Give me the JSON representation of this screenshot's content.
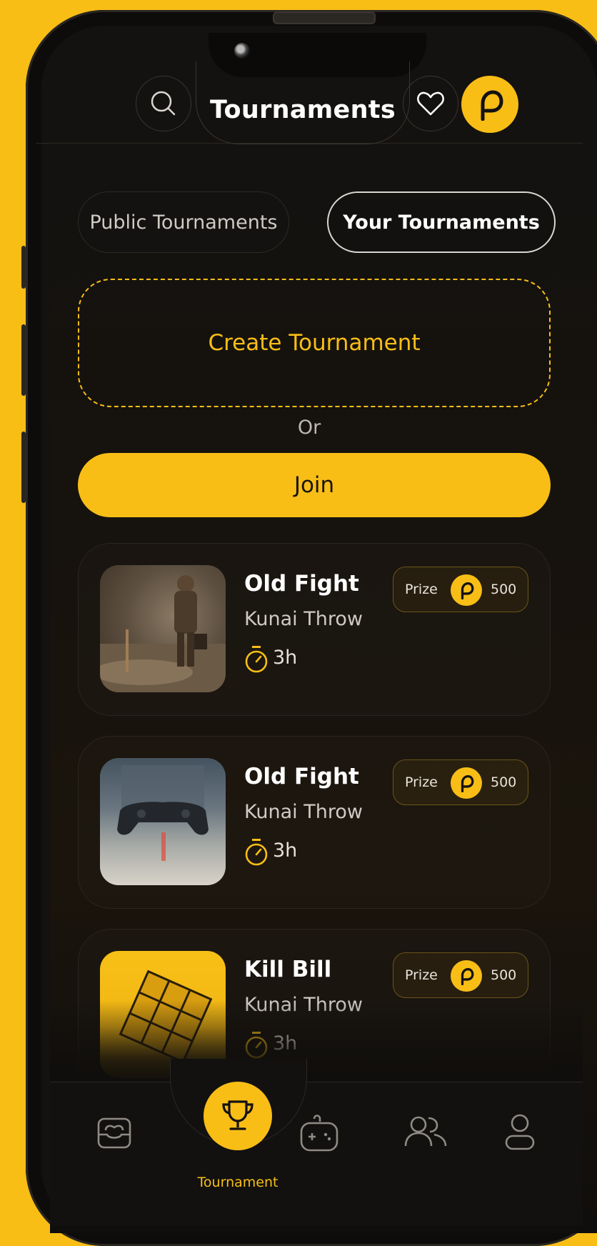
{
  "header": {
    "title": "Tournaments",
    "search_icon": "search-icon",
    "favorite_icon": "heart-icon",
    "profile_badge_letter": "P"
  },
  "tabs": [
    {
      "label": "Public Tournaments",
      "active": false
    },
    {
      "label": "Your Tournaments",
      "active": true
    }
  ],
  "create": {
    "label": "Create Tournament"
  },
  "separator": "Or",
  "join": {
    "label": "Join"
  },
  "tournaments": [
    {
      "title": "Old Fight",
      "game": "Kunai Throw",
      "time": "3h",
      "prize_label": "Prize",
      "prize_amount": "500"
    },
    {
      "title": "Old Fight",
      "game": "Kunai Throw",
      "time": "3h",
      "prize_label": "Prize",
      "prize_amount": "500"
    },
    {
      "title": "Kill Bill",
      "game": "Kunai Throw",
      "time": "3h",
      "prize_label": "Prize",
      "prize_amount": "500"
    }
  ],
  "bottom_nav": {
    "items": [
      "inbox-icon",
      "trophy-icon",
      "gamepad-icon",
      "friends-icon",
      "profile-icon"
    ],
    "active_label": "Tournament"
  },
  "colors": {
    "accent": "#F8BE16",
    "background": "#131211",
    "text": "#FFFFFF"
  }
}
